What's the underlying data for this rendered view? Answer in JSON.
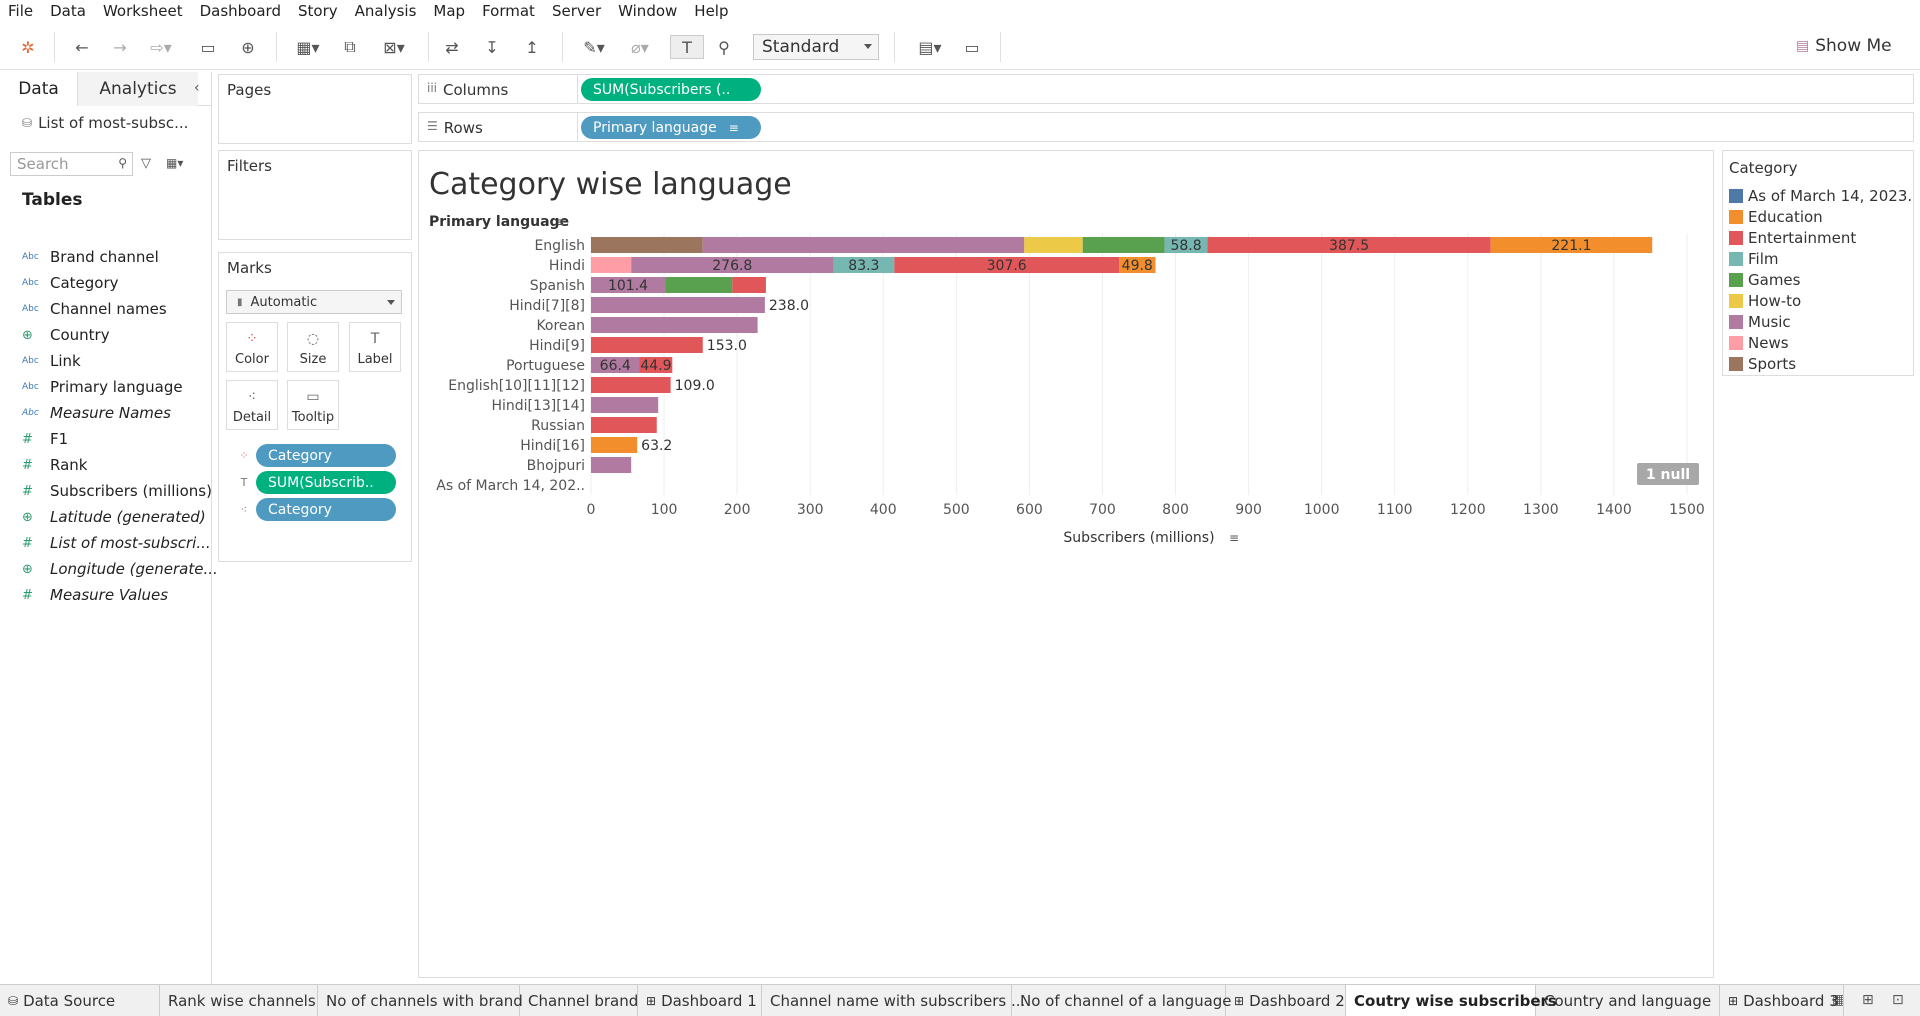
{
  "menu": [
    "File",
    "Data",
    "Worksheet",
    "Dashboard",
    "Story",
    "Analysis",
    "Map",
    "Format",
    "Server",
    "Window",
    "Help"
  ],
  "toolbar": {
    "fit_mode": "Standard",
    "show_me": "Show Me"
  },
  "left": {
    "tab_data": "Data",
    "tab_analytics": "Analytics",
    "datasource": "List of most-subsc...",
    "search_placeholder": "Search",
    "tables_heading": "Tables",
    "fields": [
      {
        "type": "Abc",
        "name": "Brand channel"
      },
      {
        "type": "Abc",
        "name": "Category"
      },
      {
        "type": "Abc",
        "name": "Channel names"
      },
      {
        "type": "geo",
        "name": "Country"
      },
      {
        "type": "Abc",
        "name": "Link"
      },
      {
        "type": "Abc",
        "name": "Primary language"
      },
      {
        "type": "Abc",
        "name": "Measure Names"
      },
      {
        "type": "#",
        "name": "F1"
      },
      {
        "type": "#",
        "name": "Rank"
      },
      {
        "type": "#",
        "name": "Subscribers (millions)"
      },
      {
        "type": "geo",
        "name": "Latitude (generated)"
      },
      {
        "type": "#",
        "name": "List of most-subscri..."
      },
      {
        "type": "geo",
        "name": "Longitude (generate..."
      },
      {
        "type": "#",
        "name": "Measure Values"
      }
    ]
  },
  "cards": {
    "pages": "Pages",
    "filters": "Filters",
    "marks": "Marks",
    "mark_type": "Automatic",
    "buttons": [
      "Color",
      "Size",
      "Label",
      "Detail",
      "Tooltip"
    ],
    "mark_pills": [
      "Category",
      "SUM(Subscrib..",
      "Category"
    ]
  },
  "shelves": {
    "columns_label": "Columns",
    "columns_pill": "SUM(Subscribers (..",
    "rows_label": "Rows",
    "rows_pill": "Primary language"
  },
  "legend": {
    "title": "Category",
    "items": [
      {
        "label": "As of March 14, 2023..",
        "color": "#4e79a7"
      },
      {
        "label": "Education",
        "color": "#f28e2b"
      },
      {
        "label": "Entertainment",
        "color": "#e15759"
      },
      {
        "label": "Film",
        "color": "#76b7b2"
      },
      {
        "label": "Games",
        "color": "#59a14f"
      },
      {
        "label": "How-to",
        "color": "#edc948"
      },
      {
        "label": "Music",
        "color": "#b07aa1"
      },
      {
        "label": "News",
        "color": "#ff9da7"
      },
      {
        "label": "Sports",
        "color": "#9c755f"
      }
    ]
  },
  "null_indicator": "1 null",
  "chart_data": {
    "type": "bar",
    "orientation": "horizontal-stacked",
    "title": "Category wise language",
    "ylabel": "Primary language",
    "xlabel": "Subscribers (millions)",
    "xlim": [
      0,
      1500
    ],
    "xticks": [
      0,
      100,
      200,
      300,
      400,
      500,
      600,
      700,
      800,
      900,
      1000,
      1100,
      1200,
      1300,
      1400,
      1500
    ],
    "categories": [
      "English",
      "Hindi",
      "Spanish",
      "Hindi[7][8]",
      "Korean",
      "Hindi[9]",
      "Portuguese",
      "English[10][11][12]",
      "Hindi[13][14]",
      "Russian",
      "Hindi[16]",
      "Bhojpuri",
      "As of March 14, 202.."
    ],
    "rows": [
      {
        "segments": [
          {
            "c": "Sports",
            "v": 153,
            "label": ""
          },
          {
            "c": "Music",
            "v": 440,
            "label": ""
          },
          {
            "c": "How-to",
            "v": 80,
            "label": ""
          },
          {
            "c": "Games",
            "v": 112,
            "label": ""
          },
          {
            "c": "Film",
            "v": 58.8,
            "label": "58.8"
          },
          {
            "c": "Entertainment",
            "v": 387.5,
            "label": "387.5"
          },
          {
            "c": "Education",
            "v": 221.1,
            "label": "221.1"
          }
        ],
        "total_label": ""
      },
      {
        "segments": [
          {
            "c": "News",
            "v": 55,
            "label": ""
          },
          {
            "c": "Music",
            "v": 276.8,
            "label": "276.8"
          },
          {
            "c": "Film",
            "v": 83.3,
            "label": "83.3"
          },
          {
            "c": "Entertainment",
            "v": 307.6,
            "label": "307.6"
          },
          {
            "c": "Education",
            "v": 49.8,
            "label": "49.8"
          }
        ],
        "total_label": ""
      },
      {
        "segments": [
          {
            "c": "Music",
            "v": 101.4,
            "label": "101.4"
          },
          {
            "c": "Games",
            "v": 92,
            "label": ""
          },
          {
            "c": "Entertainment",
            "v": 46,
            "label": ""
          }
        ],
        "total_label": ""
      },
      {
        "segments": [
          {
            "c": "Music",
            "v": 238,
            "label": ""
          }
        ],
        "total_label": "238.0"
      },
      {
        "segments": [
          {
            "c": "Music",
            "v": 228,
            "label": ""
          }
        ],
        "total_label": ""
      },
      {
        "segments": [
          {
            "c": "Entertainment",
            "v": 153,
            "label": ""
          }
        ],
        "total_label": "153.0"
      },
      {
        "segments": [
          {
            "c": "Music",
            "v": 66.4,
            "label": "66.4"
          },
          {
            "c": "Entertainment",
            "v": 44.9,
            "label": "44.9"
          }
        ],
        "total_label": ""
      },
      {
        "segments": [
          {
            "c": "Entertainment",
            "v": 109,
            "label": ""
          }
        ],
        "total_label": "109.0"
      },
      {
        "segments": [
          {
            "c": "Music",
            "v": 92,
            "label": ""
          }
        ],
        "total_label": ""
      },
      {
        "segments": [
          {
            "c": "Entertainment",
            "v": 90,
            "label": ""
          }
        ],
        "total_label": ""
      },
      {
        "segments": [
          {
            "c": "Education",
            "v": 63.2,
            "label": ""
          }
        ],
        "total_label": "63.2"
      },
      {
        "segments": [
          {
            "c": "Music",
            "v": 55,
            "label": ""
          }
        ],
        "total_label": ""
      },
      {
        "segments": [],
        "total_label": ""
      }
    ]
  },
  "sheet_tabs": [
    {
      "label": "Data Source",
      "icon": "datasource-icon"
    },
    {
      "label": "Rank wise channels"
    },
    {
      "label": "No of channels with brand"
    },
    {
      "label": "Channel brand"
    },
    {
      "label": "Dashboard 1",
      "icon": "dashboard-icon"
    },
    {
      "label": "Channel name with subscribers ..."
    },
    {
      "label": "No of channel of a language"
    },
    {
      "label": "Dashboard 2",
      "icon": "dashboard-icon"
    },
    {
      "label": "Coutry wise subscribers",
      "active": true
    },
    {
      "label": "Country and language"
    },
    {
      "label": "Dashboard 3",
      "icon": "dashboard-icon"
    }
  ]
}
